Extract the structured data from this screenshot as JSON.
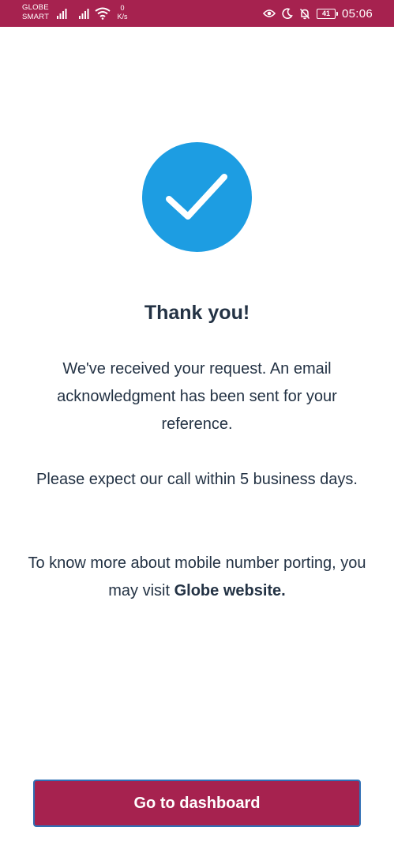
{
  "status_bar": {
    "carrier_line1": "GLOBE",
    "carrier_line2": "SMART",
    "speed_value": "0",
    "speed_unit": "K/s",
    "battery_level": "41",
    "time": "05:06",
    "icons": [
      "signal-icon",
      "signal-icon",
      "wifi-icon",
      "eye-icon",
      "moon-icon",
      "bell-muted-icon",
      "battery-icon"
    ],
    "background_color": "#a6224f"
  },
  "main": {
    "success_icon": "check-icon",
    "circle_color": "#1d9de2",
    "title": "Thank you!",
    "message_1": "We've received your request. An email acknowledgment has been sent for your reference.",
    "message_2": "Please expect our call within 5 business days.",
    "message_3_prefix": "To know more about mobile number porting, you may visit ",
    "message_3_link": "Globe website."
  },
  "footer": {
    "button_label": "Go to dashboard",
    "button_color": "#a6224f"
  }
}
